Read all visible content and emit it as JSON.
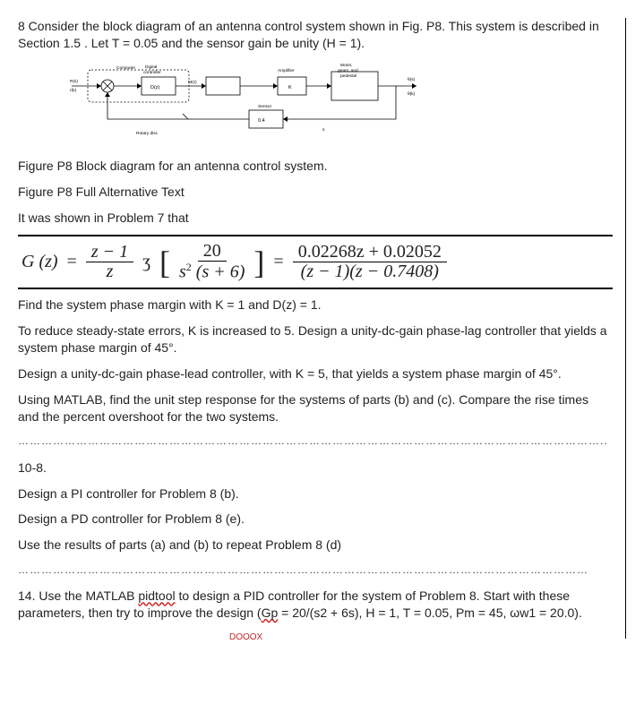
{
  "problem8": {
    "intro": "8 Consider the block diagram of an antenna control system shown in Fig. P8. This system is described in Section 1.5 . Let T = 0.05 and the sensor gain be unity (H = 1).",
    "caption1": "Figure P8 Block diagram for an antenna control system.",
    "caption2": "Figure P8 Full Alternative Text",
    "reference": "It was shown in Problem 7 that",
    "eq": {
      "lhs": "G (z)",
      "f1_num": "z  −  1",
      "f1_den": "z",
      "f2_num": "20",
      "f2_den_a": "s",
      "f2_den_b": " (s   +   6)",
      "r_num": "0.02268z  +  0.02052",
      "r_den": "(z − 1)(z − 0.7408)"
    },
    "tasks": [
      "Find the system phase margin with K = 1 and D(z) = 1.",
      "To reduce steady-state errors, K is increased to 5. Design a unity-dc-gain phase-lag controller that yields a system phase margin of 45°.",
      "Design a unity-dc-gain phase-lead controller, with K = 5, that yields a system phase margin of 45°.",
      "Using MATLAB, find the unit step response for the systems of parts (b) and (c). Compare the rise times and the percent overshoot for the two systems."
    ],
    "sep1": "……………………………………………………………………………………………………………………………………..",
    "p108_heading": "10-8.",
    "p108_tasks": [
      "Design a PI controller for Problem 8 (b).",
      "Design a PD controller for Problem 8 (e).",
      "Use the results of parts (a) and (b) to repeat Problem 8 (d)"
    ],
    "sep2": "…………………………………………………………………………………………………………………………………",
    "p14_a": "14. Use the MATLAB ",
    "p14_tool": "pidtool",
    "p14_b": " to design a PID controller for the system of Problem 8. Start with these parameters, then try to improve the design (",
    "p14_gp": "Gp",
    "p14_c": " = 20/(s2 + 6s), H = 1, T = 0.05, Pm = 45, ωw1 = 20.0).",
    "redmark": "DOOOX"
  },
  "diagram": {
    "comp": "Computer",
    "dig1": "Digital",
    "dig2": "controller",
    "dz": "D(z)",
    "amp": "Amplifier",
    "K": "K",
    "mot1": "Motor,",
    "mot2": "gears, and",
    "mot3": "pedestal",
    "sensor": "Sensor",
    "h": "0.4",
    "r1": "R(s)",
    "r2": "r(k)",
    "m": "M(z)",
    "s": "s",
    "rot": "Rotary disc",
    "out": "θ(s)",
    "out2": "θ(k)"
  }
}
